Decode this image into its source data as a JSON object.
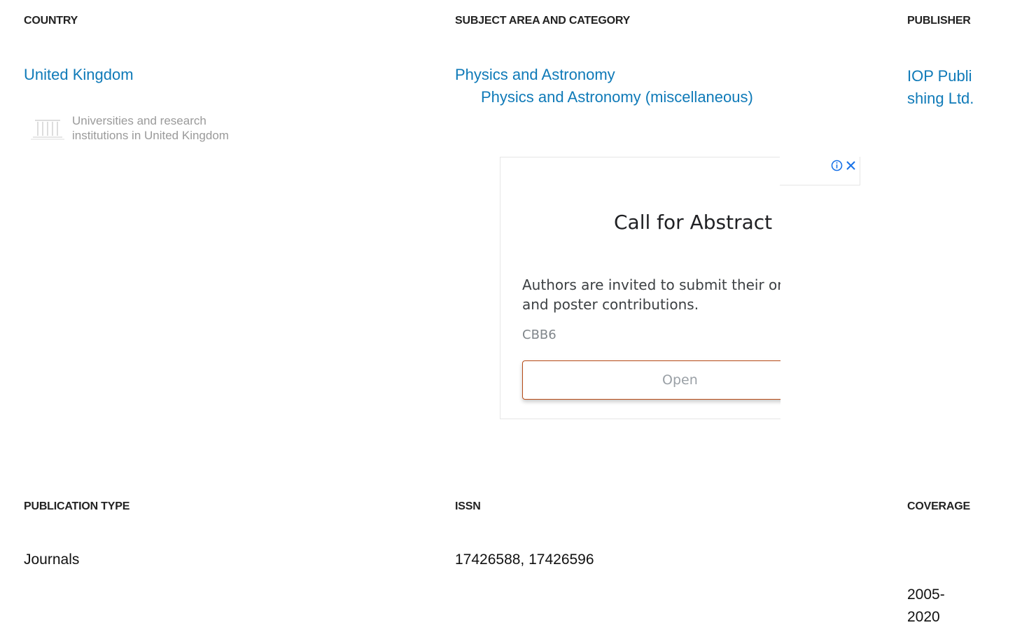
{
  "country": {
    "heading": "COUNTRY",
    "value": "United Kingdom",
    "institutions_link": "Universities and research institutions in United Kingdom"
  },
  "subject": {
    "heading": "SUBJECT AREA AND CATEGORY",
    "area": "Physics and Astronomy",
    "category": "Physics and Astronomy (miscellaneous)"
  },
  "publisher": {
    "heading": "PUBLISHER",
    "value": "IOP Publishing Ltd."
  },
  "ad": {
    "title": "Call for Abstract",
    "body": "Authors are invited to submit their oral and poster contributions.",
    "advertiser": "CBB6",
    "button_label": "Open",
    "info_icon": "info-icon",
    "close_icon": "close-icon",
    "accent_color": "#1a73e8",
    "button_border_color": "#b74b17"
  },
  "publication_type": {
    "heading": "PUBLICATION TYPE",
    "value": "Journals"
  },
  "issn": {
    "heading": "ISSN",
    "value": "17426588, 17426596"
  },
  "coverage": {
    "heading": "COVERAGE",
    "value": "2005-2020"
  },
  "colors": {
    "link": "#0f7ab8",
    "heading": "#222222",
    "muted": "#9a9a9a"
  }
}
